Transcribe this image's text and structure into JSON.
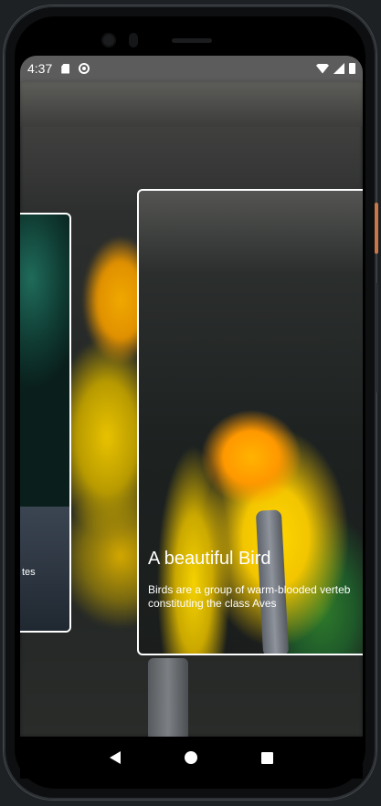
{
  "status_bar": {
    "time": "4:37",
    "icons": [
      "sd-card-icon",
      "sync-icon",
      "wifi-icon",
      "signal-icon",
      "battery-icon"
    ]
  },
  "cards": [
    {
      "partial_text": "tes"
    },
    {
      "title": "A beautiful Bird",
      "description_line1": "Birds are a group of warm-blooded verteb",
      "description_line2": "constituting the class Aves"
    }
  ],
  "nav_bar": {
    "icons": [
      "back-icon",
      "home-icon",
      "recents-icon"
    ]
  },
  "colors": {
    "status_bar": "#5c5c5c",
    "card_border": "#ffffff",
    "nav_bar": "#000000"
  }
}
